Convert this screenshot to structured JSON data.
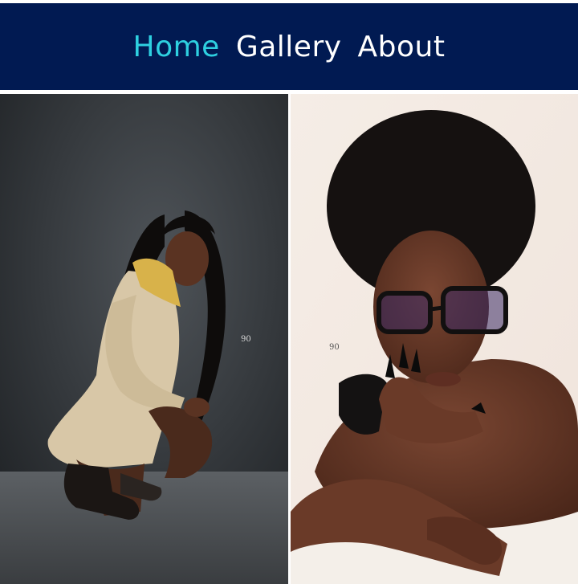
{
  "nav": {
    "items": [
      {
        "label": "Home",
        "active": true
      },
      {
        "label": "Gallery",
        "active": false
      },
      {
        "label": "About",
        "active": false
      }
    ],
    "background": "#011a52",
    "active_color": "#2ed0e0",
    "text_color": "#ffffff"
  },
  "gallery": {
    "photos": [
      {
        "subject": "woman crouching in beige trench coat with long braids, dark studio backdrop",
        "watermark": "90"
      },
      {
        "subject": "close-up of woman with afro hair and glasses, long black nails, light background",
        "watermark": "90"
      }
    ]
  }
}
